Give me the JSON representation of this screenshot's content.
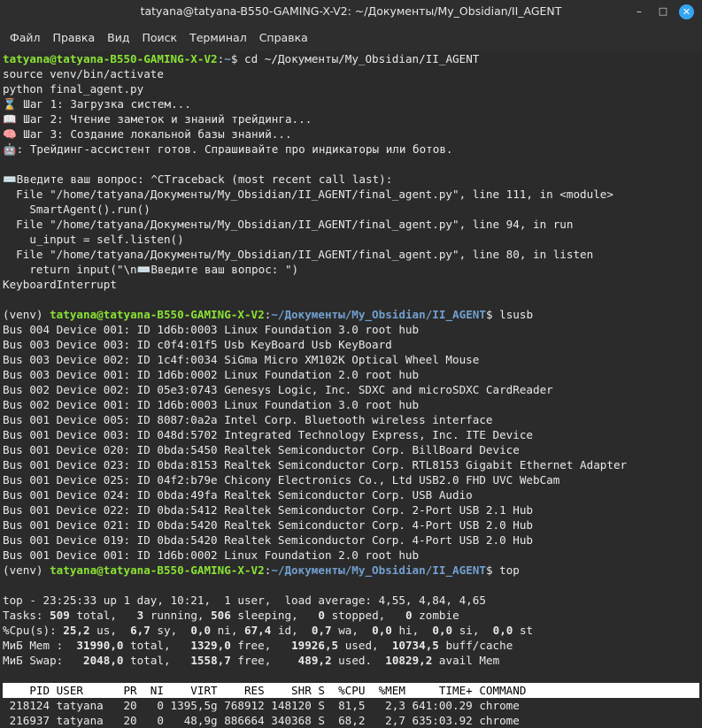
{
  "window": {
    "title": "tatyana@tatyana-B550-GAMING-X-V2: ~/Документы/My_Obsidian/II_AGENT",
    "minimize": "–",
    "maximize": "□",
    "close": "✕"
  },
  "menu": [
    "Файл",
    "Правка",
    "Вид",
    "Поиск",
    "Терминал",
    "Справка"
  ],
  "prompt": {
    "venv": "(venv) ",
    "user_host": "tatyana@tatyana-B550-GAMING-X-V2",
    "sep": ":",
    "home": "~",
    "path": "~/Документы/My_Obsidian/II_AGENT",
    "dollar": "$ "
  },
  "commands": {
    "cd": "cd ~/Документы/My_Obsidian/II_AGENT",
    "lsusb": "lsusb",
    "top": "top"
  },
  "session": [
    "source venv/bin/activate",
    "python final_agent.py",
    "⌛ Шаг 1: Загрузка систем...",
    "📖 Шаг 2: Чтение заметок и знаний трейдинга...",
    "🧠 Шаг 3: Создание локальной базы знаний...",
    "🤖: Трейдинг-ассистент готов. Спрашивайте про индикаторы или ботов.",
    "",
    "⌨️Введите ваш вопрос: ^CTraceback (most recent call last):",
    "  File \"/home/tatyana/Документы/My_Obsidian/II_AGENT/final_agent.py\", line 111, in <module>",
    "    SmartAgent().run()",
    "  File \"/home/tatyana/Документы/My_Obsidian/II_AGENT/final_agent.py\", line 94, in run",
    "    u_input = self.listen()",
    "  File \"/home/tatyana/Документы/My_Obsidian/II_AGENT/final_agent.py\", line 80, in listen",
    "    return input(\"\\n⌨️Введите ваш вопрос: \")",
    "KeyboardInterrupt",
    ""
  ],
  "lsusb_output": [
    "Bus 004 Device 001: ID 1d6b:0003 Linux Foundation 3.0 root hub",
    "Bus 003 Device 003: ID c0f4:01f5 Usb KeyBoard Usb KeyBoard",
    "Bus 003 Device 002: ID 1c4f:0034 SiGma Micro XM102K Optical Wheel Mouse",
    "Bus 003 Device 001: ID 1d6b:0002 Linux Foundation 2.0 root hub",
    "Bus 002 Device 002: ID 05e3:0743 Genesys Logic, Inc. SDXC and microSDXC CardReader",
    "Bus 002 Device 001: ID 1d6b:0003 Linux Foundation 3.0 root hub",
    "Bus 001 Device 005: ID 8087:0a2a Intel Corp. Bluetooth wireless interface",
    "Bus 001 Device 003: ID 048d:5702 Integrated Technology Express, Inc. ITE Device",
    "Bus 001 Device 020: ID 0bda:5450 Realtek Semiconductor Corp. BillBoard Device",
    "Bus 001 Device 023: ID 0bda:8153 Realtek Semiconductor Corp. RTL8153 Gigabit Ethernet Adapter",
    "Bus 001 Device 025: ID 04f2:b79e Chicony Electronics Co., Ltd USB2.0 FHD UVC WebCam",
    "Bus 001 Device 024: ID 0bda:49fa Realtek Semiconductor Corp. USB Audio",
    "Bus 001 Device 022: ID 0bda:5412 Realtek Semiconductor Corp. 2-Port USB 2.1 Hub",
    "Bus 001 Device 021: ID 0bda:5420 Realtek Semiconductor Corp. 4-Port USB 2.0 Hub",
    "Bus 001 Device 019: ID 0bda:5420 Realtek Semiconductor Corp. 4-Port USB 2.0 Hub",
    "Bus 001 Device 001: ID 1d6b:0002 Linux Foundation 2.0 root hub"
  ],
  "top": {
    "blank": "",
    "summary": "top - 23:25:33 up 1 day, 10:21,  1 user,  load average: 4,55, 4,84, 4,65",
    "tasks": [
      {
        "t": "Tasks: "
      },
      {
        "t": "509",
        "b": true
      },
      {
        "t": " total,   "
      },
      {
        "t": "3",
        "b": true
      },
      {
        "t": " running, "
      },
      {
        "t": "506",
        "b": true
      },
      {
        "t": " sleeping,   "
      },
      {
        "t": "0",
        "b": true
      },
      {
        "t": " stopped,   "
      },
      {
        "t": "0",
        "b": true
      },
      {
        "t": " zombie"
      }
    ],
    "cpu": [
      {
        "t": "%Cpu(s): "
      },
      {
        "t": "25,2",
        "b": true
      },
      {
        "t": " us,  "
      },
      {
        "t": "6,7",
        "b": true
      },
      {
        "t": " sy,  "
      },
      {
        "t": "0,0",
        "b": true
      },
      {
        "t": " ni, "
      },
      {
        "t": "67,4",
        "b": true
      },
      {
        "t": " id,  "
      },
      {
        "t": "0,7",
        "b": true
      },
      {
        "t": " wa,  "
      },
      {
        "t": "0,0",
        "b": true
      },
      {
        "t": " hi,  "
      },
      {
        "t": "0,0",
        "b": true
      },
      {
        "t": " si,  "
      },
      {
        "t": "0,0",
        "b": true
      },
      {
        "t": " st"
      }
    ],
    "mem": [
      {
        "t": "МиБ Mem :  "
      },
      {
        "t": "31990,0",
        "b": true
      },
      {
        "t": " total,   "
      },
      {
        "t": "1329,0",
        "b": true
      },
      {
        "t": " free,   "
      },
      {
        "t": "19926,5",
        "b": true
      },
      {
        "t": " used,  "
      },
      {
        "t": "10734,5",
        "b": true
      },
      {
        "t": " buff/cache"
      }
    ],
    "swap": [
      {
        "t": "МиБ Swap:   "
      },
      {
        "t": "2048,0",
        "b": true
      },
      {
        "t": " total,   "
      },
      {
        "t": "1558,7",
        "b": true
      },
      {
        "t": " free,    "
      },
      {
        "t": "489,2",
        "b": true
      },
      {
        "t": " used.  "
      },
      {
        "t": "10829,2",
        "b": true
      },
      {
        "t": " avail Mem"
      }
    ],
    "header": "    PID USER      PR  NI    VIRT    RES    SHR S  %CPU  %MEM     TIME+ COMMAND",
    "processes": [
      " 218124 tatyana   20   0 1395,5g 768912 148120 S  81,5   2,3 641:00.29 chrome",
      " 216937 tatyana   20   0   48,9g 886664 340368 S  68,2   2,7 635:03.92 chrome"
    ]
  },
  "colors": {
    "background": "#2b2b2b",
    "text": "#e9e9e9",
    "user_host": "#8ae234",
    "path": "#729fcf",
    "close_button": "#35a5f2"
  }
}
